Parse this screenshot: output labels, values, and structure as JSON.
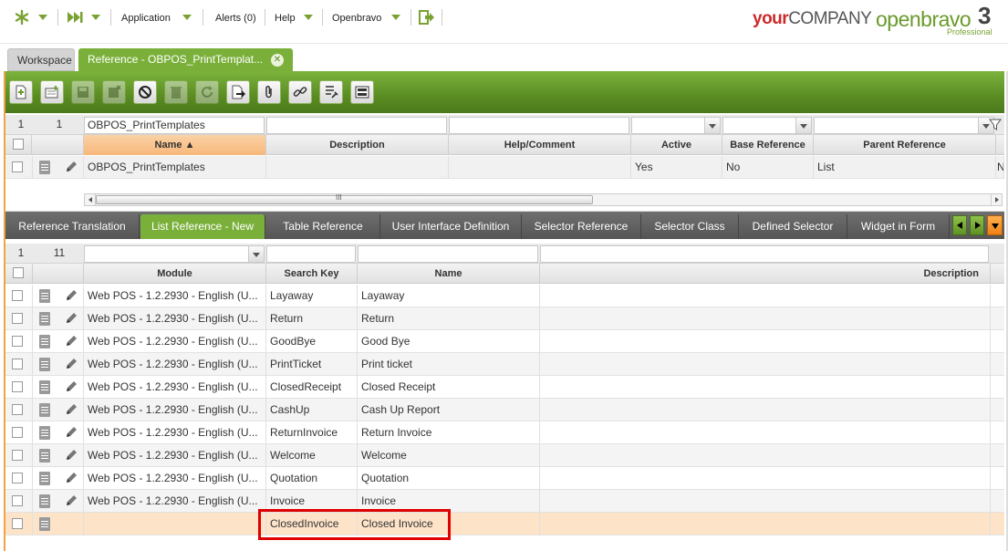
{
  "topnav": {
    "application": "Application",
    "alerts": "Alerts (0)",
    "help": "Help",
    "openbravo": "Openbravo"
  },
  "logos": {
    "company_your": "your",
    "company_name": "COMPANY",
    "product": "openbravo",
    "edition": "Professional",
    "version": "3"
  },
  "tabs": {
    "workspace": "Workspace",
    "active": "Reference - OBPOS_PrintTemplat...",
    "close_glyph": "✕"
  },
  "header_grid": {
    "row_number": "1",
    "record_count": "1",
    "name_filter": "OBPOS_PrintTemplates",
    "columns": [
      "Name ▲",
      "Description",
      "Help/Comment",
      "Active",
      "Base Reference",
      "Parent Reference"
    ],
    "row": {
      "name": "OBPOS_PrintTemplates",
      "description": "",
      "help": "",
      "active": "Yes",
      "base_reference": "No",
      "parent_reference": "List",
      "overflow": "N"
    },
    "hscroll_grip": "III"
  },
  "subtabs": [
    "Reference Translation",
    "List Reference - New",
    "Table Reference",
    "User Interface Definition",
    "Selector Reference",
    "Selector Class",
    "Defined Selector",
    "Widget in Form"
  ],
  "list_grid": {
    "row_number": "1",
    "record_count": "11",
    "columns": [
      "Module",
      "Search Key",
      "Name",
      "Description"
    ],
    "rows": [
      {
        "module": "Web POS - 1.2.2930 - English (U...",
        "key": "Layaway",
        "name": "Layaway"
      },
      {
        "module": "Web POS - 1.2.2930 - English (U...",
        "key": "Return",
        "name": "Return"
      },
      {
        "module": "Web POS - 1.2.2930 - English (U...",
        "key": "GoodBye",
        "name": "Good Bye"
      },
      {
        "module": "Web POS - 1.2.2930 - English (U...",
        "key": "PrintTicket",
        "name": "Print ticket"
      },
      {
        "module": "Web POS - 1.2.2930 - English (U...",
        "key": "ClosedReceipt",
        "name": "Closed Receipt"
      },
      {
        "module": "Web POS - 1.2.2930 - English (U...",
        "key": "CashUp",
        "name": "Cash Up Report"
      },
      {
        "module": "Web POS - 1.2.2930 - English (U...",
        "key": "ReturnInvoice",
        "name": "Return Invoice"
      },
      {
        "module": "Web POS - 1.2.2930 - English (U...",
        "key": "Welcome",
        "name": "Welcome"
      },
      {
        "module": "Web POS - 1.2.2930 - English (U...",
        "key": "Quotation",
        "name": "Quotation"
      },
      {
        "module": "Web POS - 1.2.2930 - English (U...",
        "key": "Invoice",
        "name": "Invoice"
      },
      {
        "module": "",
        "key": "ClosedInvoice",
        "name": "Closed Invoice"
      }
    ]
  },
  "colors": {
    "brand_green": "#7ab03a",
    "highlight_row": "#fde3c8",
    "annotation_red": "#e00000"
  }
}
